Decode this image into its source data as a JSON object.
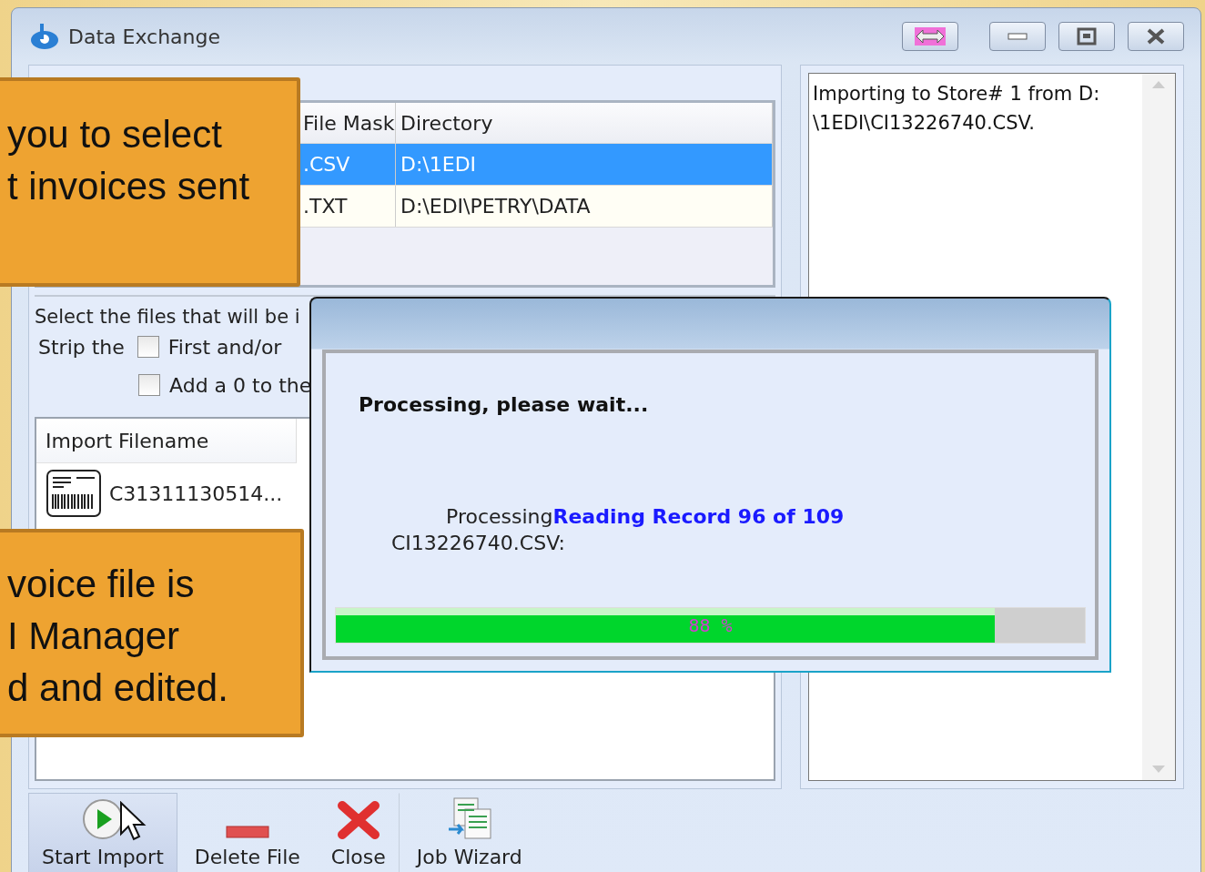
{
  "window": {
    "title": "Data Exchange"
  },
  "templates": {
    "columns": [
      "",
      "File Mask",
      "Directory"
    ],
    "rows": [
      {
        "cells": [
          "",
          ".CSV",
          "D:\\1EDI"
        ],
        "selected": true
      },
      {
        "cells": [
          "",
          ".TXT",
          "D:\\EDI\\PETRY\\DATA"
        ],
        "selected": false
      }
    ]
  },
  "options": {
    "instruction": "Select the files that will be i",
    "strip_label": "Strip the",
    "checkboxes": [
      {
        "label": "First and/or",
        "checked": false
      },
      {
        "label": "Add a 0 to the",
        "checked": false
      }
    ]
  },
  "files": {
    "column": "Import Filename",
    "rows": [
      {
        "name": "C31311130514..."
      }
    ]
  },
  "log": {
    "lines": [
      "Importing to Store# 1 from D:",
      "\\1EDI\\CI13226740.CSV."
    ]
  },
  "toolbar": [
    {
      "label": "Start Import",
      "kind": "start",
      "selected": true
    },
    {
      "label": "Delete File",
      "kind": "delete",
      "selected": false
    },
    {
      "label": "Close",
      "kind": "close",
      "selected": false
    },
    {
      "label": "Job Wizard",
      "kind": "wizard",
      "selected": false
    }
  ],
  "dialog": {
    "heading": "Processing, please wait...",
    "status_prefix": "Processing",
    "status": "Reading Record 96 of 109",
    "file": "CI13226740.CSV:",
    "progress": {
      "level": 0.88,
      "reading": "88 %"
    }
  },
  "callouts": [
    {
      "lines": [
        "you to select",
        "t invoices sent"
      ]
    },
    {
      "lines": [
        "voice file is",
        "I Manager",
        "d and edited."
      ]
    }
  ]
}
